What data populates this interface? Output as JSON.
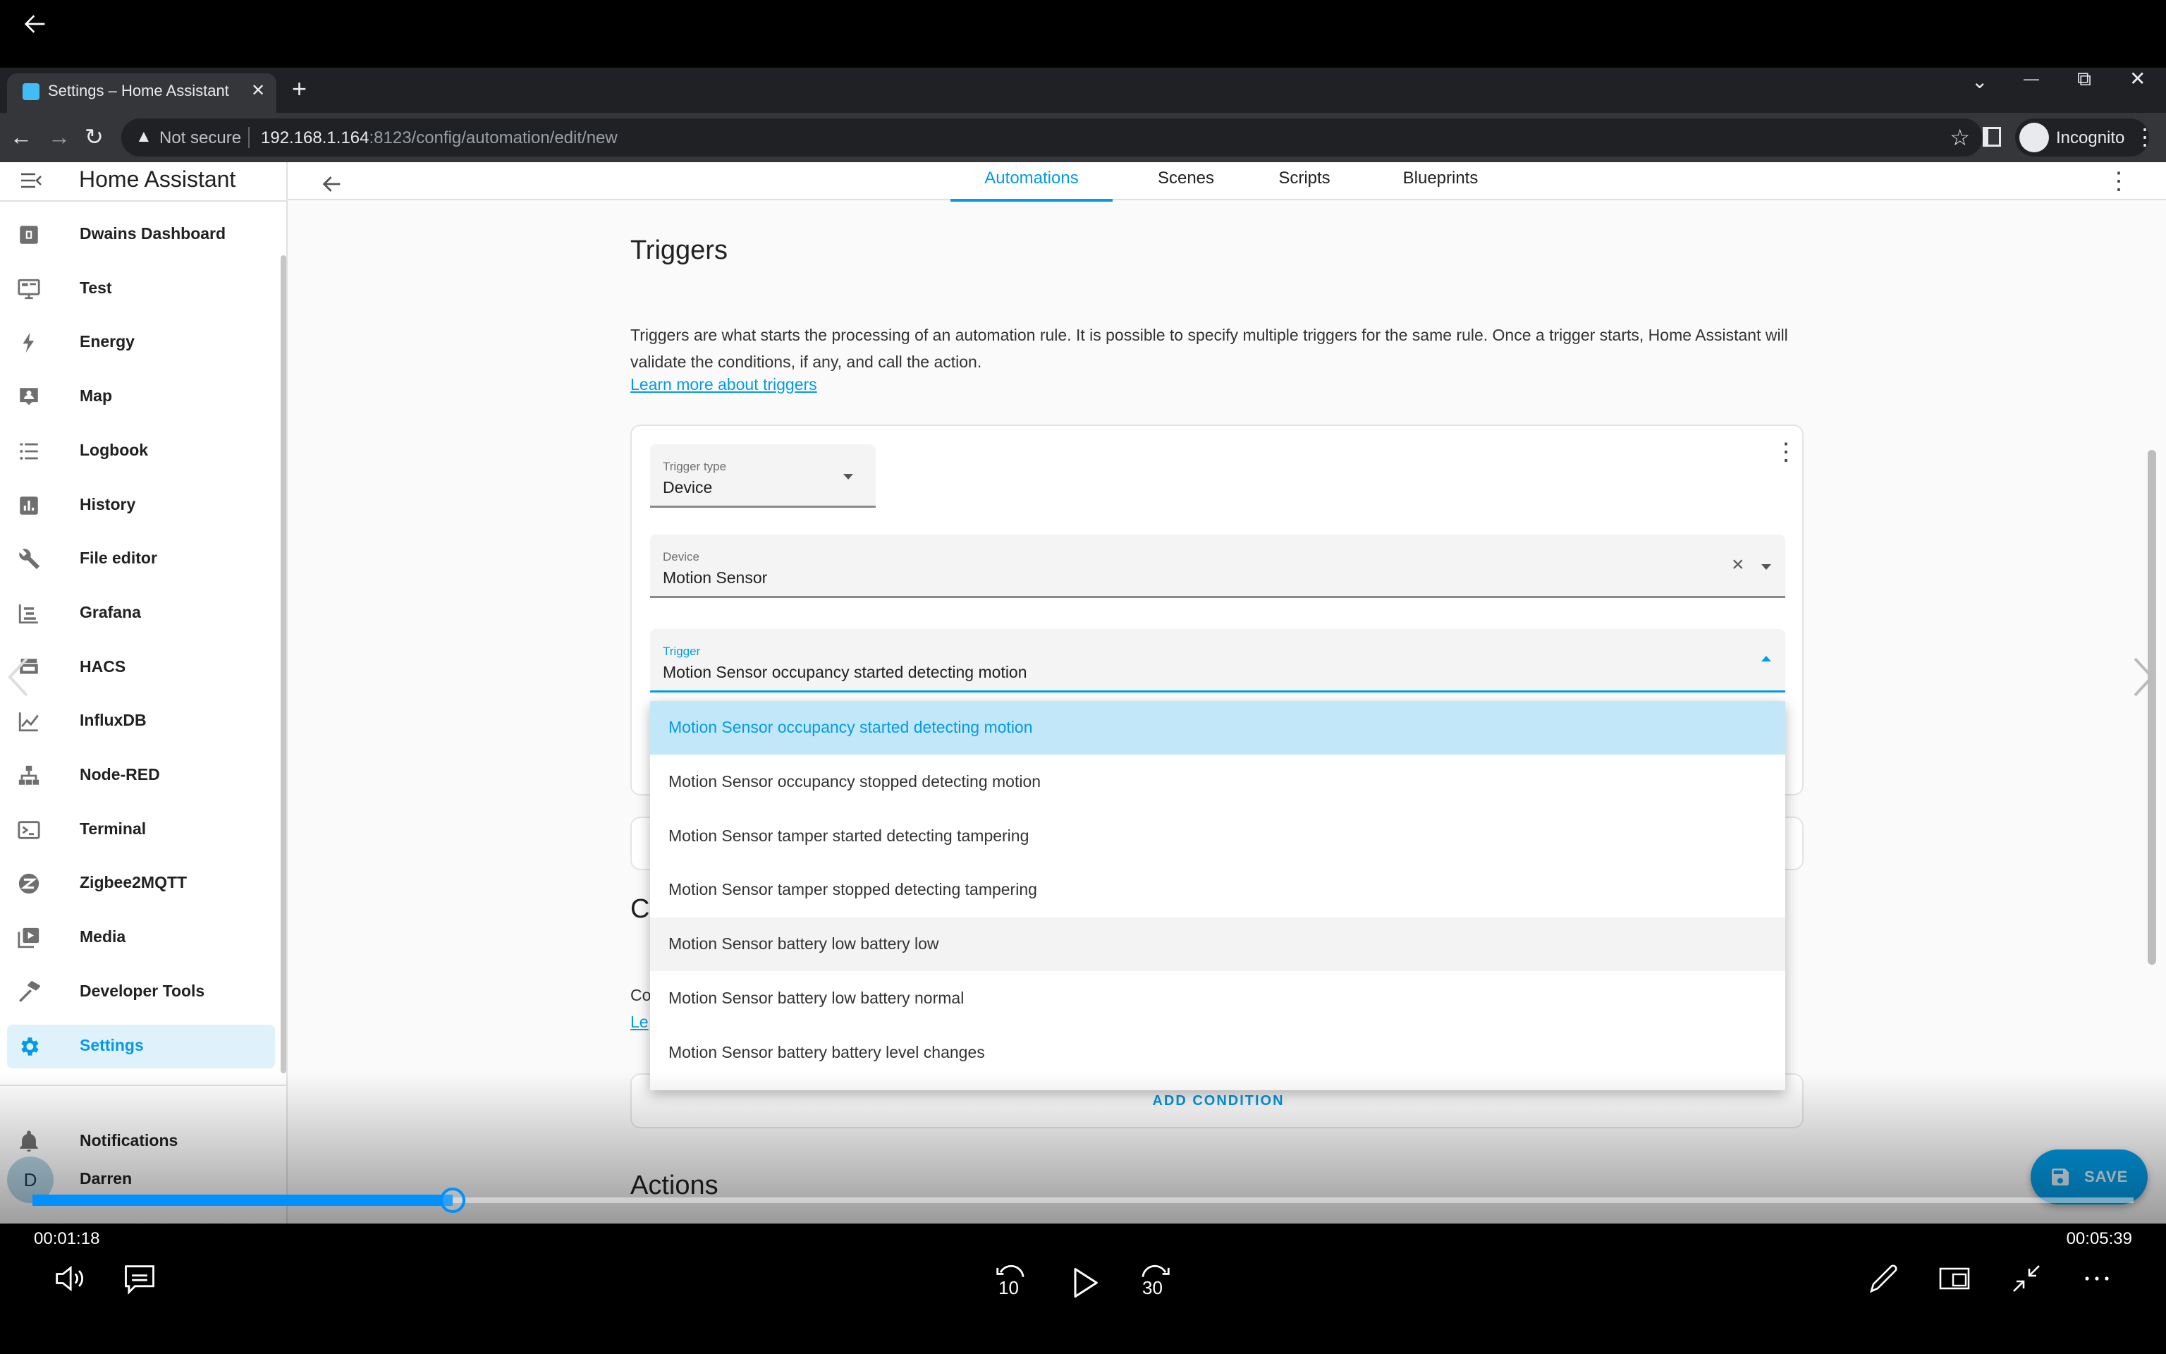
{
  "player": {
    "current_time": "00:01:18",
    "total_time": "00:05:39",
    "progress_fraction": 0.2,
    "controls": {
      "volume_icon": "volume-icon",
      "captions_icon": "captions-icon",
      "rewind_label": "10",
      "forward_label": "30",
      "play_icon": "play-icon",
      "edit_icon": "pencil-icon",
      "miniplayer_icon": "miniplayer-icon",
      "exit_fullscreen_icon": "exit-fullscreen-icon",
      "more_icon": "more-icon"
    }
  },
  "browser": {
    "tab_title": "Settings – Home Assistant",
    "tab_close": "✕",
    "new_tab": "+",
    "security_label": "Not secure",
    "url_host": "192.168.1.164",
    "url_rest": ":8123/config/automation/edit/new",
    "profile_label": "Incognito",
    "window_controls": {
      "dropdown": "⌄",
      "minimize": "—",
      "restore": "⧉",
      "close": "✕"
    }
  },
  "app": {
    "title": "Home Assistant",
    "sidebar": {
      "items": [
        {
          "label": "Dwains Dashboard",
          "icon": "dashboard-d-icon"
        },
        {
          "label": "Test",
          "icon": "monitor-dashboard-icon"
        },
        {
          "label": "Energy",
          "icon": "lightning-bolt-icon"
        },
        {
          "label": "Map",
          "icon": "map-person-icon"
        },
        {
          "label": "Logbook",
          "icon": "list-icon"
        },
        {
          "label": "History",
          "icon": "chart-box-icon"
        },
        {
          "label": "File editor",
          "icon": "wrench-icon"
        },
        {
          "label": "Grafana",
          "icon": "chart-gantt-icon"
        },
        {
          "label": "HACS",
          "icon": "hacs-store-icon"
        },
        {
          "label": "InfluxDB",
          "icon": "chart-areaspline-icon"
        },
        {
          "label": "Node-RED",
          "icon": "sitemap-icon"
        },
        {
          "label": "Terminal",
          "icon": "console-icon"
        },
        {
          "label": "Zigbee2MQTT",
          "icon": "zigbee-icon"
        },
        {
          "label": "Media",
          "icon": "play-box-multiple-icon"
        },
        {
          "label": "Developer Tools",
          "icon": "hammer-icon"
        },
        {
          "label": "Settings",
          "icon": "cog-icon",
          "active": true
        }
      ],
      "notifications_label": "Notifications",
      "user_name": "Darren",
      "user_initial": "D"
    },
    "header": {
      "tabs": [
        {
          "label": "Automations",
          "active": true
        },
        {
          "label": "Scenes"
        },
        {
          "label": "Scripts"
        },
        {
          "label": "Blueprints"
        }
      ]
    },
    "triggers": {
      "title": "Triggers",
      "description": "Triggers are what starts the processing of an automation rule. It is possible to specify multiple triggers for the same rule. Once a trigger starts, Home Assistant will validate the conditions, if any, and call the action.",
      "learn_more": "Learn more about triggers",
      "trigger_type_label": "Trigger type",
      "trigger_type_value": "Device",
      "device_label": "Device",
      "device_value": "Motion Sensor",
      "trigger_label": "Trigger",
      "trigger_value": "Motion Sensor occupancy started detecting motion",
      "options": [
        "Motion Sensor occupancy started detecting motion",
        "Motion Sensor occupancy stopped detecting motion",
        "Motion Sensor tamper started detecting tampering",
        "Motion Sensor tamper stopped detecting tampering",
        "Motion Sensor battery low battery low",
        "Motion Sensor battery low battery normal",
        "Motion Sensor battery battery level changes"
      ],
      "selected_index": 0,
      "hover_index": 4
    },
    "conditions": {
      "title_visible": "C",
      "desc_visible": "Co",
      "link_visible": "Le",
      "add_label": "ADD CONDITION"
    },
    "actions": {
      "title": "Actions"
    },
    "save_label": "SAVE"
  },
  "colors": {
    "accent": "#039be5",
    "seek": "#0091ff"
  }
}
